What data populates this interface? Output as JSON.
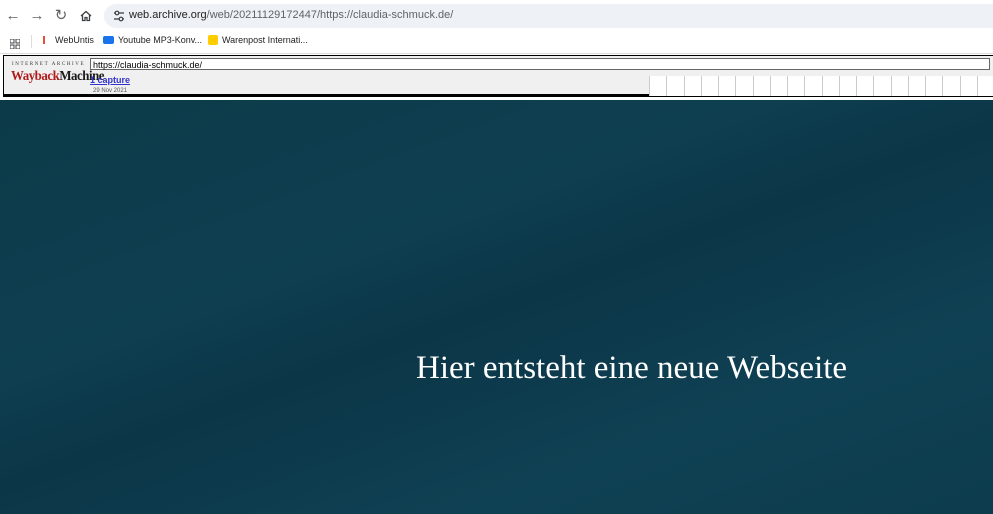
{
  "browser": {
    "url_domain": "web.archive.org",
    "url_rest": "/web/20211129172447/https://claudia-schmuck.de/"
  },
  "bookmarks": [
    {
      "label": "WebUntis"
    },
    {
      "label": "Youtube MP3-Konv..."
    },
    {
      "label": "Warenpost Internati..."
    }
  ],
  "wayback": {
    "logo_top": "INTERNET ARCHIVE",
    "logo_main": "Wayback",
    "logo_machine": "Machine",
    "url_input": "https://claudia-schmuck.de/",
    "captures": "1 capture",
    "date": "29 Nov 2021"
  },
  "page": {
    "headline": "Hier entsteht eine neue Webseite"
  },
  "colors": {
    "background": "#0d3a4a",
    "headline": "#ffffff",
    "wayback_red": "#b01c1c"
  }
}
